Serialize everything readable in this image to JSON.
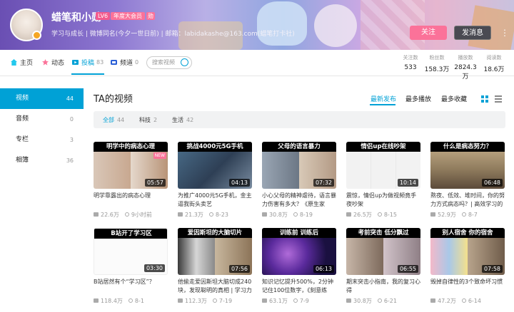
{
  "profile": {
    "name": "蜡笔和小勋",
    "level": "LV6",
    "vip": "年度大会员",
    "medal": "勋",
    "sign": "学习与成长 | 微博同名(今夕一世日前) | 邮箱：labidakashe@163.com(蜡笔打卡社)",
    "follow_label": "关注",
    "message_label": "发消息",
    "more_icon": "dots-icon"
  },
  "nav": {
    "items": [
      {
        "label": "主页",
        "icon": "home-icon"
      },
      {
        "label": "动态",
        "icon": "activity-icon"
      },
      {
        "label": "投稿",
        "count": "83",
        "icon": "upload-icon"
      },
      {
        "label": "频道",
        "count": "0",
        "icon": "channel-icon"
      }
    ],
    "search_placeholder": "搜索视频",
    "stats": [
      {
        "label": "关注数",
        "value": "533"
      },
      {
        "label": "粉丝数",
        "value": "158.3万"
      },
      {
        "label": "播放数",
        "value": "2824.3万"
      },
      {
        "label": "阅读数",
        "value": "18.6万"
      }
    ]
  },
  "sidebar": [
    {
      "label": "视频",
      "count": "44"
    },
    {
      "label": "音频",
      "count": "0"
    },
    {
      "label": "专栏",
      "count": "3"
    },
    {
      "label": "相簿",
      "count": "36"
    }
  ],
  "main": {
    "title": "TA的视频",
    "sort": [
      "最新发布",
      "最多播放",
      "最多收藏"
    ],
    "filters": [
      {
        "label": "全部",
        "count": "44"
      },
      {
        "label": "科技",
        "count": "2"
      },
      {
        "label": "生活",
        "count": "42"
      }
    ]
  },
  "videos": [
    {
      "caption": "明学中的病态心理",
      "new": "NEW",
      "duration": "05:57",
      "title": "明学靠露出的病态心理",
      "plays": "22.6万",
      "date": "9小时前"
    },
    {
      "caption": "挑战4000元5G手机",
      "duration": "04:13",
      "title": "为推广4000元5G手机，金主逼我街头卖艺",
      "plays": "21.3万",
      "date": "8-23"
    },
    {
      "caption": "父母的语言暴力",
      "duration": "07:32",
      "title": "小心父母的精神虐待，语言暴力伤害有多大？《原生家",
      "plays": "30.8万",
      "date": "8-19"
    },
    {
      "caption": "情侣up在线吵架",
      "duration": "10:14",
      "title": "震惊，情侣up为做视频竟手夜吵架",
      "plays": "26.5万",
      "date": "8-15"
    },
    {
      "caption": "什么是病态努力？",
      "duration": "06:48",
      "title": "熬夜、低效、堆时间，你的努力方式病态吗？| 高效学习的",
      "plays": "52.9万",
      "date": "8-7"
    },
    {
      "caption": "B站开了学习区",
      "duration": "03:30",
      "title": "B站居然有个“学习区”？",
      "plays": "118.4万",
      "date": "8-1"
    },
    {
      "caption": "爱因斯坦的大脑切片",
      "duration": "07:56",
      "title": "他偷走爱因斯坦大脑切成240块，发现聪明的真相 | 学习力",
      "plays": "112.3万",
      "date": "7-19"
    },
    {
      "caption": "训练前  训练后",
      "duration": "06:13",
      "title": "知识记忆提升500%，2分钟记住100位数字，《刻意练",
      "plays": "63.1万",
      "date": "7-9"
    },
    {
      "caption": "考前突击  低分飘过",
      "duration": "06:55",
      "title": "期末突击小指南，我的复习心得",
      "plays": "30.8万",
      "date": "6-21"
    },
    {
      "caption": "别人宿舍  你的宿舍",
      "duration": "07:58",
      "title": "毁掉自律性的3个致命坏习惯",
      "plays": "47.2万",
      "date": "6-14"
    }
  ],
  "colors": {
    "accent": "#00a1d6",
    "pink": "#fb7299"
  }
}
